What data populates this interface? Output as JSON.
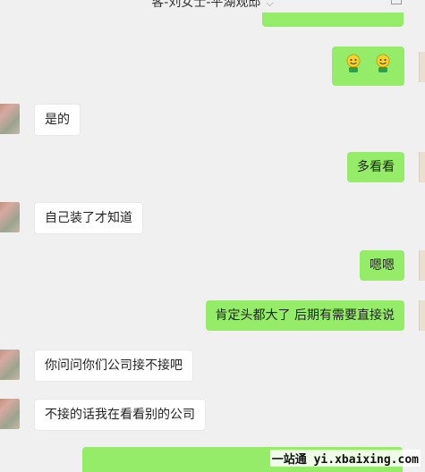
{
  "header": {
    "title": "客-刘女士-平湖观邸"
  },
  "messages": [
    {
      "side": "right",
      "type": "emoji",
      "label": "two smiling face emojis"
    },
    {
      "side": "left",
      "text": "是的"
    },
    {
      "side": "right",
      "text": "多看看"
    },
    {
      "side": "left",
      "text": "自己装了才知道"
    },
    {
      "side": "right",
      "text": "嗯嗯"
    },
    {
      "side": "right",
      "text": "肯定头都大了   后期有需要直接说"
    },
    {
      "side": "left",
      "text": "你问问你们公司接不接吧"
    },
    {
      "side": "left",
      "text": "不接的话我在看看别的公司"
    }
  ],
  "watermark": "一站通 yi.xbaixing.com",
  "colors": {
    "self_bubble": "#95ec69",
    "other_bubble": "#ffffff",
    "background": "#f0f0f0"
  },
  "icons": {
    "title_chevron": "chevron-down-icon",
    "emoji": "smile-face-icon"
  }
}
